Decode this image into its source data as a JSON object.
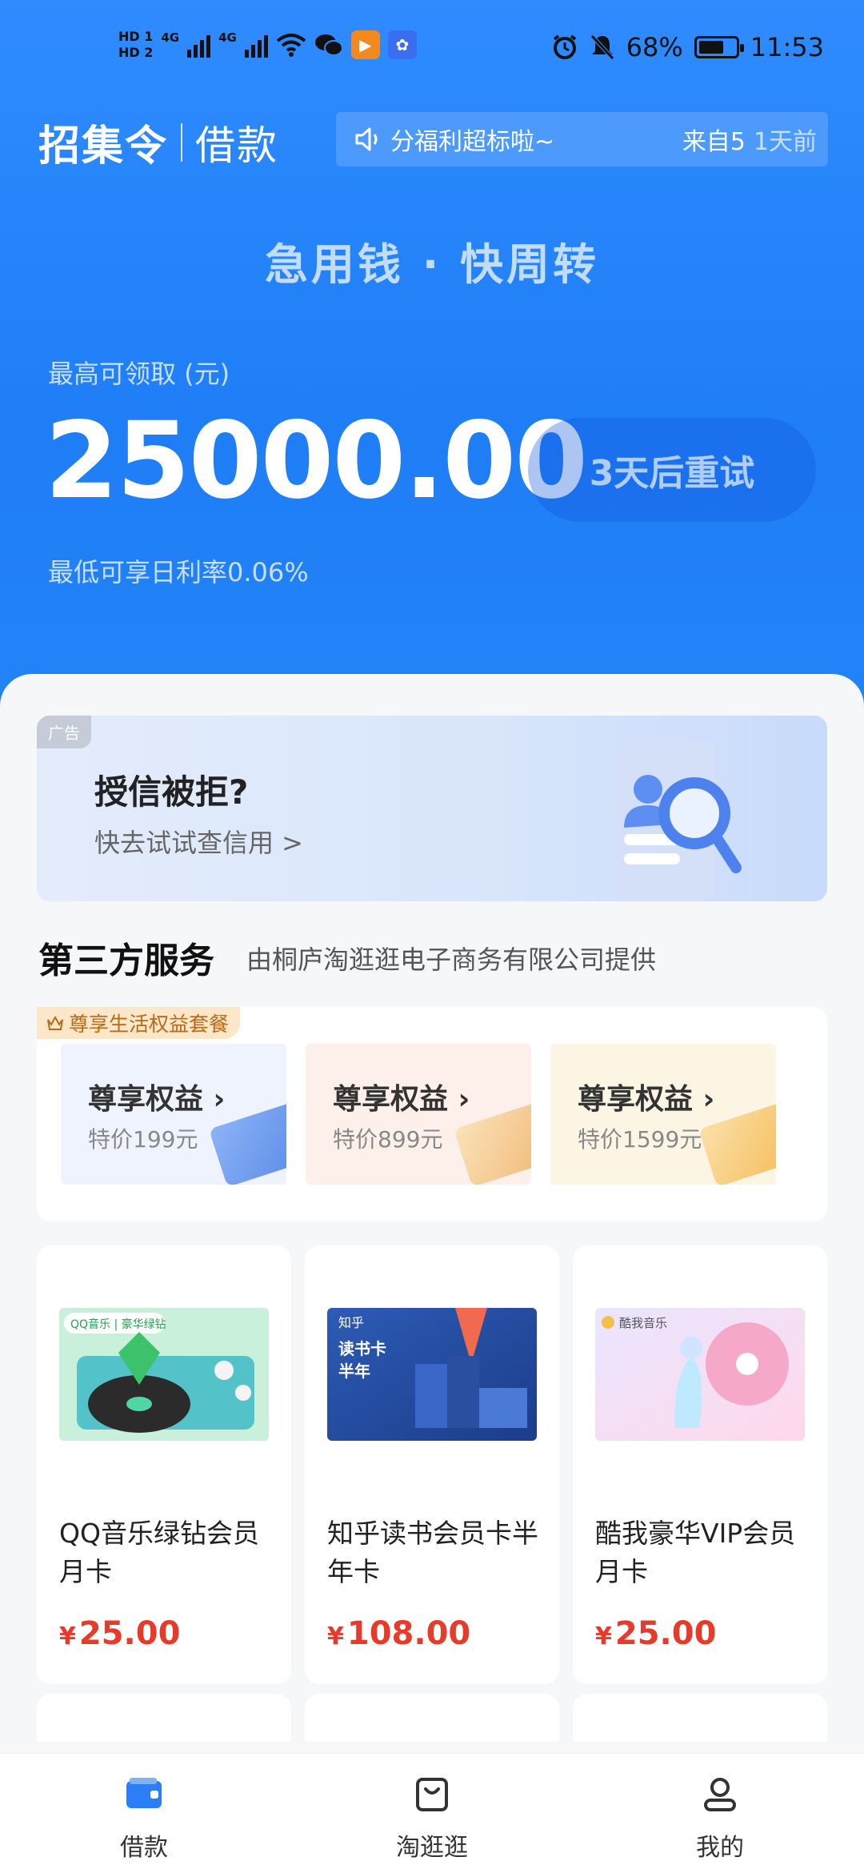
{
  "status_bar": {
    "hd1": "HD 1",
    "hd2": "HD 2",
    "net1": "4G",
    "net2": "4G",
    "battery": "68%",
    "battery_level": 0.68,
    "time": "11:53"
  },
  "header": {
    "brand": "招集令",
    "brand_sub": "借款",
    "notice_text": "分福利超标啦~",
    "notice_from": "来自5",
    "notice_time": "1天前"
  },
  "hero": {
    "slogan": "急用钱 · 快周转",
    "amount_label": "最高可领取 (元)",
    "amount": "25000.00",
    "retry_button": "3天后重试",
    "rate_text": "最低可享日利率0.06%"
  },
  "ad_banner": {
    "tag": "广告",
    "title": "授信被拒?",
    "subtitle": "快去试试查信用 >"
  },
  "third_party": {
    "title": "第三方服务",
    "provider": "由桐庐淘逛逛电子商务有限公司提供"
  },
  "perks": {
    "ribbon": "尊享生活权益套餐",
    "items": [
      {
        "title": "尊享权益 ›",
        "price": "特价199元"
      },
      {
        "title": "尊享权益 ›",
        "price": "特价899元"
      },
      {
        "title": "尊享权益 ›",
        "price": "特价1599元"
      }
    ]
  },
  "products": [
    {
      "name": "QQ音乐绿钻会员月卡",
      "currency": "¥",
      "price": "25.00",
      "img_label": "QQ音乐 | 豪华绿钻"
    },
    {
      "name": "知乎读书会员卡半年卡",
      "currency": "¥",
      "price": "108.00",
      "img_label": "知乎",
      "img_title": "读书卡",
      "img_title2": "半年"
    },
    {
      "name": "酷我豪华VIP会员月卡",
      "currency": "¥",
      "price": "25.00",
      "img_label": "酷我音乐"
    }
  ],
  "tabbar": [
    {
      "label": "借款",
      "icon": "wallet-icon",
      "active": true
    },
    {
      "label": "淘逛逛",
      "icon": "shopping-bag-icon",
      "active": false
    },
    {
      "label": "我的",
      "icon": "user-icon",
      "active": false
    }
  ],
  "colors": {
    "primary": "#2383f7",
    "price": "#e83a2b"
  }
}
